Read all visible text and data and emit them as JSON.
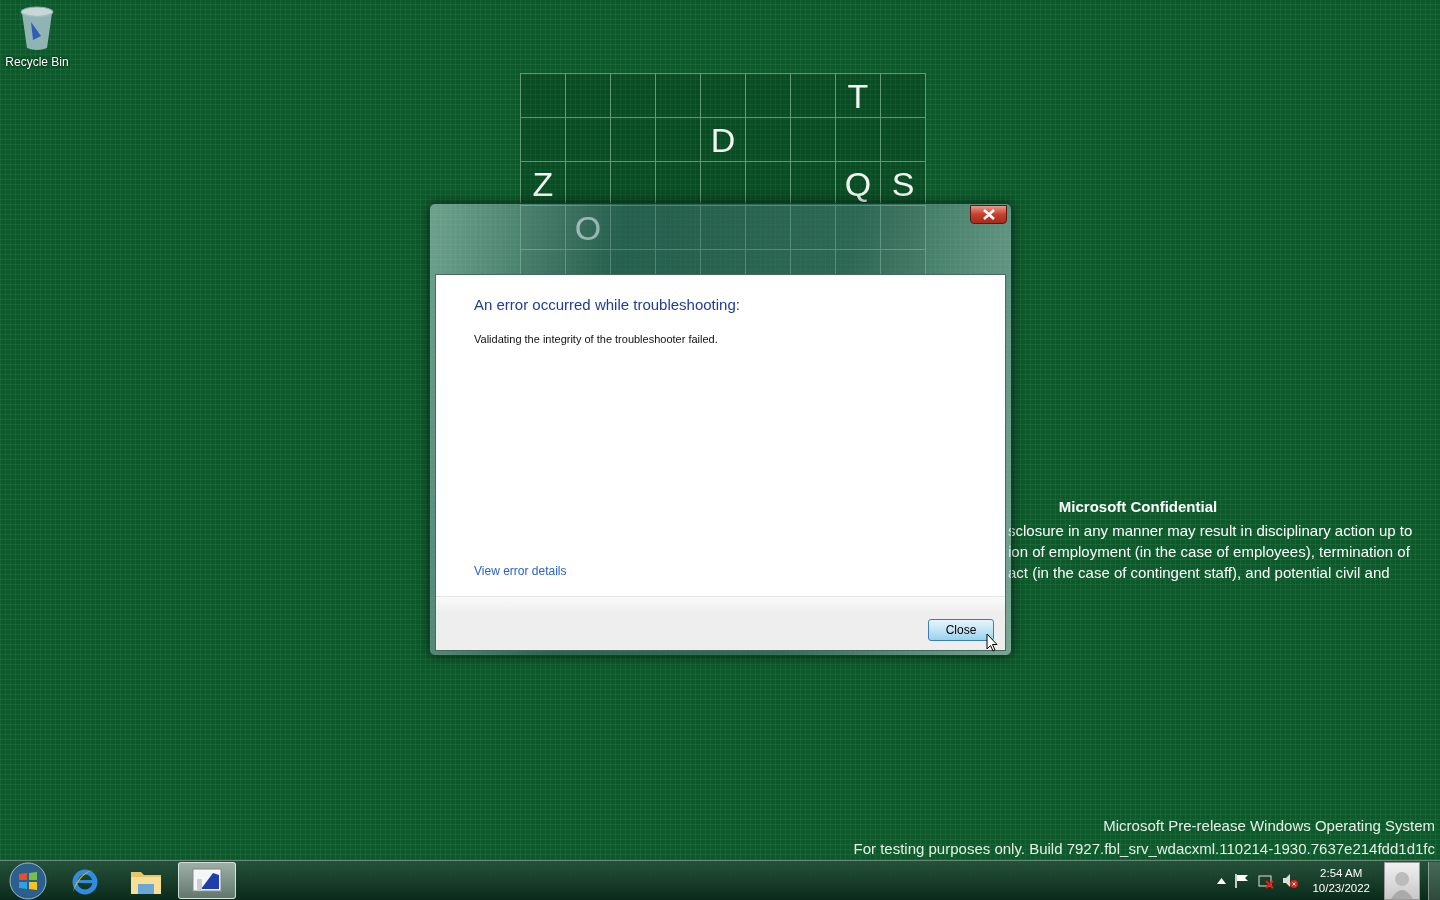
{
  "desktop": {
    "icons": [
      {
        "kind": "recycle-bin",
        "label": "Recycle Bin"
      }
    ],
    "letter_grid": {
      "rows": [
        {
          "cells": [
            {
              "kind": "empty"
            },
            {
              "kind": "empty"
            },
            {
              "kind": "empty"
            },
            {
              "kind": "empty"
            },
            {
              "kind": "empty"
            },
            {
              "kind": "empty"
            },
            {
              "kind": "empty"
            },
            {
              "kind": "letter",
              "letter": "T"
            },
            {
              "kind": "empty"
            }
          ]
        },
        {
          "cells": [
            {
              "kind": "empty"
            },
            {
              "kind": "empty"
            },
            {
              "kind": "empty"
            },
            {
              "kind": "empty"
            },
            {
              "kind": "letter",
              "letter": "D"
            },
            {
              "kind": "empty"
            },
            {
              "kind": "empty"
            },
            {
              "kind": "empty"
            },
            {
              "kind": "empty"
            }
          ]
        },
        {
          "cells": [
            {
              "kind": "letter",
              "letter": "Z"
            },
            {
              "kind": "empty"
            },
            {
              "kind": "empty"
            },
            {
              "kind": "empty"
            },
            {
              "kind": "empty"
            },
            {
              "kind": "empty"
            },
            {
              "kind": "empty"
            },
            {
              "kind": "letter",
              "letter": "Q"
            },
            {
              "kind": "letter",
              "letter": "S"
            }
          ]
        },
        {
          "cells": [
            {
              "kind": "empty"
            },
            {
              "kind": "letter",
              "letter": "O"
            },
            {
              "kind": "empty"
            },
            {
              "kind": "empty"
            },
            {
              "kind": "empty"
            },
            {
              "kind": "empty"
            },
            {
              "kind": "empty"
            },
            {
              "kind": "empty"
            },
            {
              "kind": "empty"
            }
          ]
        },
        {
          "cells": [
            {
              "kind": "empty"
            },
            {
              "kind": "empty"
            },
            {
              "kind": "empty"
            },
            {
              "kind": "empty"
            },
            {
              "kind": "empty"
            },
            {
              "kind": "empty"
            },
            {
              "kind": "empty"
            },
            {
              "kind": "empty"
            },
            {
              "kind": "empty"
            }
          ]
        }
      ]
    },
    "confidential_notice": {
      "title": "Microsoft Confidential",
      "lines": [
        "sclosure in any manner may result in disciplinary action up to",
        "ion of employment (in the case of employees), termination of",
        "act (in the case of contingent staff), and potential civil and"
      ]
    },
    "build_info": [
      "Microsoft Pre-release Windows Operating System",
      "For testing purposes only. Build 7927.fbl_srv_wdacxml.110214-1930.7637e214fdd1d1fc"
    ]
  },
  "dialog": {
    "heading": "An error occurred while troubleshooting:",
    "message": "Validating the integrity of the troubleshooter failed.",
    "link": "View error details",
    "buttons": [
      "Close"
    ]
  },
  "taskbar": {
    "apps": [
      {
        "kind": "browser",
        "selected": false
      },
      {
        "kind": "folder",
        "selected": false
      },
      {
        "kind": "troubleshooter",
        "selected": true
      }
    ],
    "clock": {
      "time": "2:54 AM",
      "date": "10/23/2022"
    }
  }
}
